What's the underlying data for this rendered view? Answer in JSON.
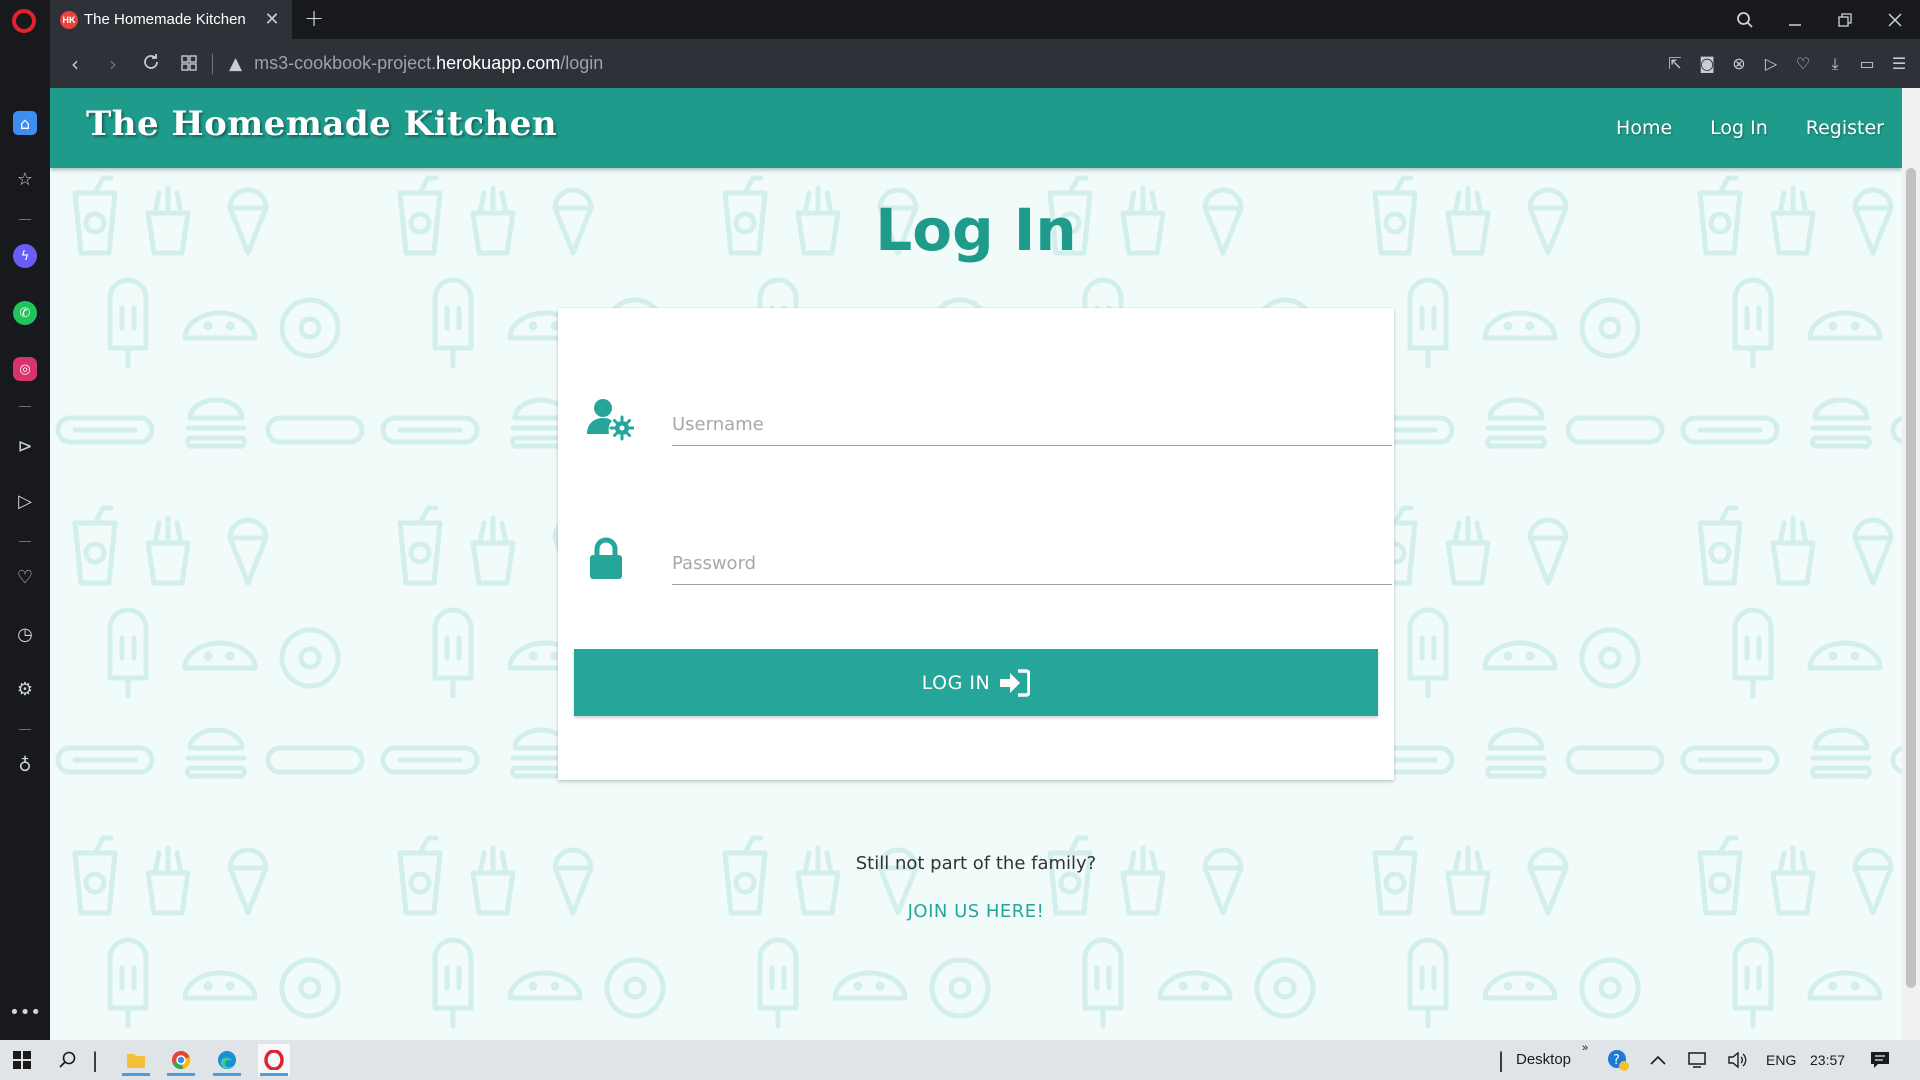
{
  "browser": {
    "tab_title": "The Homemade Kitchen",
    "tab_favicon_text": "HK",
    "url_domain_prefix": "ms3-cookbook-project.",
    "url_host": "herokuapp.com",
    "url_path": "/login"
  },
  "site": {
    "brand": "The Homemade Kitchen",
    "nav": [
      {
        "label": "Home"
      },
      {
        "label": "Log In"
      },
      {
        "label": "Register"
      }
    ],
    "accent_color": "#26a69a",
    "navbar_color": "#1f9b8c"
  },
  "login": {
    "title": "Log In",
    "username_placeholder": "Username",
    "password_placeholder": "Password",
    "button_label": "LOG IN",
    "join_prompt": "Still not part of the family?",
    "join_link": "JOIN US HERE!"
  },
  "taskbar": {
    "desktop_label": "Desktop",
    "language": "ENG",
    "time": "23:57"
  }
}
